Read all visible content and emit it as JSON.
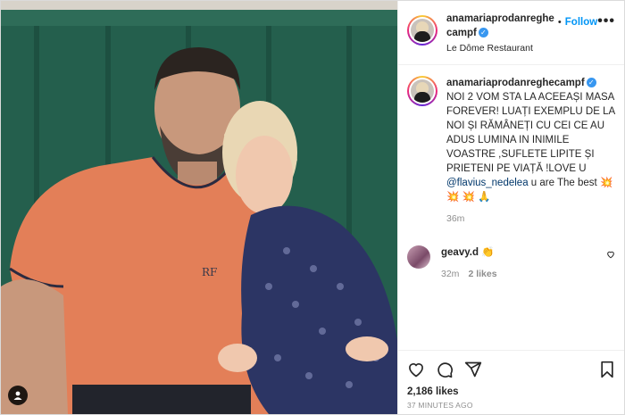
{
  "post": {
    "username": "anamariaprodanreghecampf",
    "location": "Le Dôme Restaurant",
    "follow_label": "Follow",
    "more_label": "•••",
    "caption": {
      "username": "anamariaprodanreghecampf",
      "text_before": " NOI 2 VOM STA LA ACEEAȘI MASA FOREVER! LUAȚI EXEMPLU DE LA NOI ȘI RĂMÂNEȚI CU CEI CE AU ADUS LUMINA IN INIMILE VOASTRE ,SUFLETE LIPITE ȘI PRIETENI PE VIAȚĂ !LOVE U ",
      "mention": "@flavius_nedelea",
      "text_after": " u are The best 💥 💥 💥 🙏",
      "time": "36m"
    },
    "comments": [
      {
        "username": "geavy.d",
        "text": "👏",
        "time": "32m",
        "likes": "2 likes"
      }
    ],
    "likes_count": "2,186 likes",
    "posted_ago": "37 MINUTES AGO"
  },
  "colors": {
    "accent": "#0095f6",
    "verified": "#3897f0",
    "text": "#262626",
    "muted": "#8e8e8e"
  },
  "icons": [
    "heart-icon",
    "comment-icon",
    "share-icon",
    "bookmark-icon",
    "user-tag-icon",
    "verified-badge-icon"
  ]
}
